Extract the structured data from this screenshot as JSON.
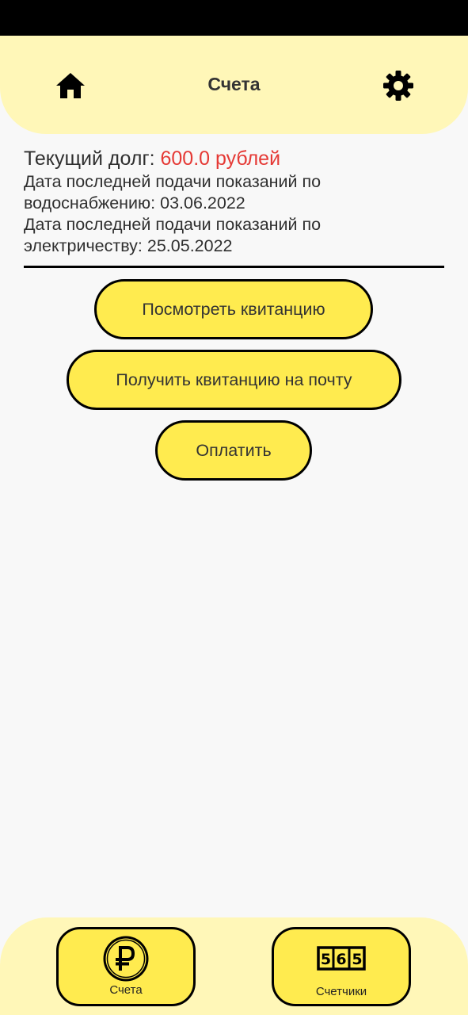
{
  "header": {
    "title": "Счета",
    "home_icon": "home-icon",
    "settings_icon": "gear-icon"
  },
  "info": {
    "debt_label": "Текущий долг:",
    "debt_value": "600.0 рублей",
    "water_label": "Дата последней подачи показаний по водоснабжению:",
    "water_date": "03.06.2022",
    "electricity_label": "Дата последней подачи показаний по электричеству:",
    "electricity_date": "25.05.2022"
  },
  "actions": {
    "view_receipt": "Посмотреть квитанцию",
    "email_receipt": "Получить квитанцию на почту",
    "pay": "Оплатить"
  },
  "bottom_nav": {
    "bills_label": "Счета",
    "bills_icon": "ruble-coin-icon",
    "meters_label": "Счетчики",
    "meters_icon": "meter-counter-icon"
  },
  "colors": {
    "accent_yellow": "#ffeb4f",
    "panel_yellow": "#fff7b8",
    "debt_red": "#e53935",
    "background": "#f8f8f8"
  }
}
